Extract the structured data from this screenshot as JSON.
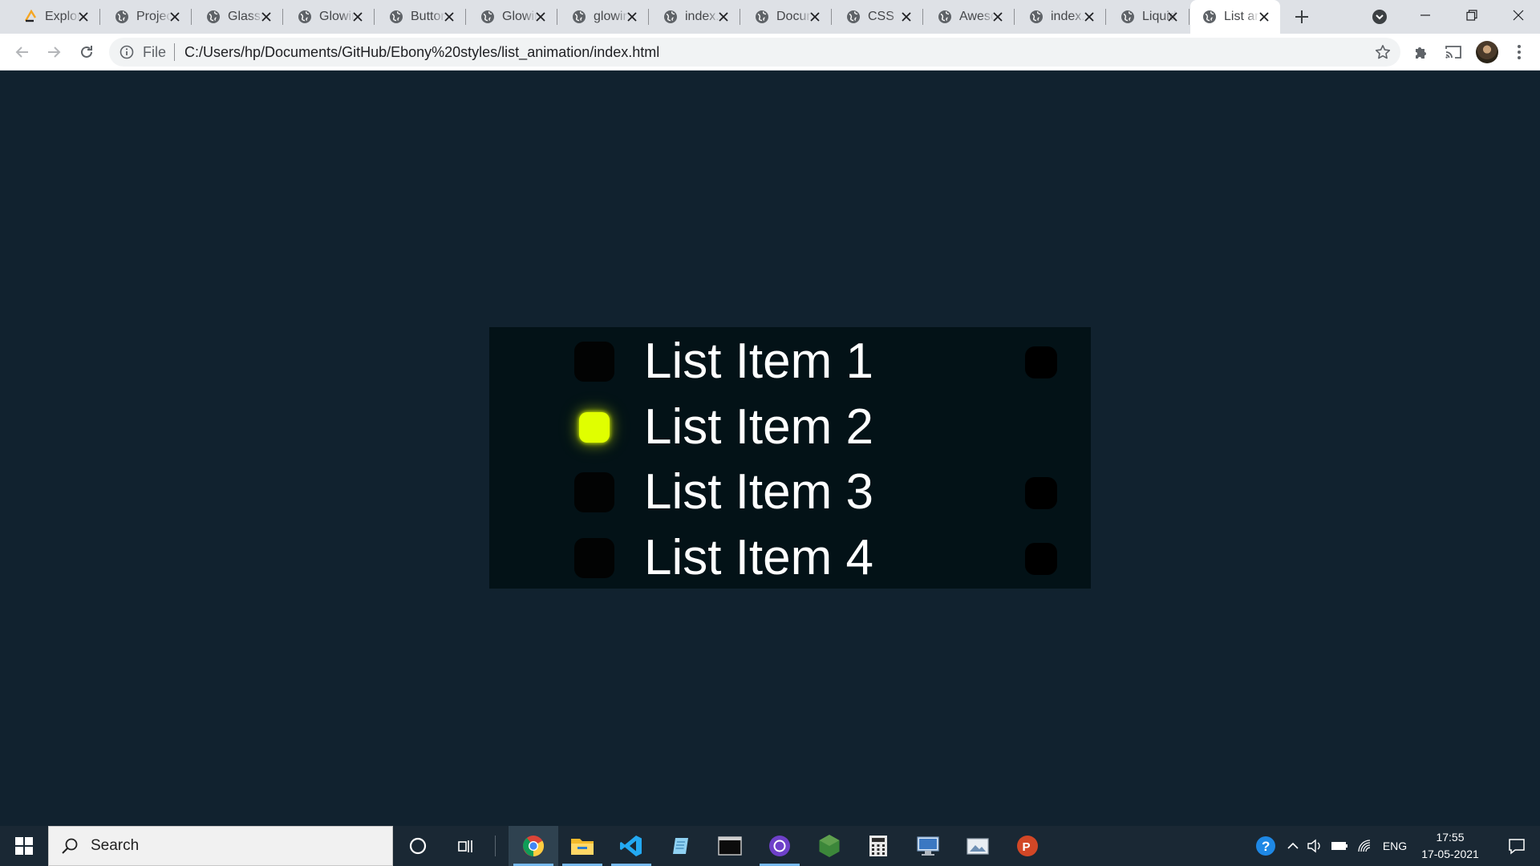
{
  "browser": {
    "tabs": [
      {
        "title": "Explore GitHub",
        "favicon": "codepen-icon"
      },
      {
        "title": "Projects",
        "favicon": "globe-icon"
      },
      {
        "title": "Glassmorphism",
        "favicon": "globe-icon"
      },
      {
        "title": "Glowing",
        "favicon": "globe-icon"
      },
      {
        "title": "Button",
        "favicon": "globe-icon"
      },
      {
        "title": "Glowing",
        "favicon": "globe-icon"
      },
      {
        "title": "glowing",
        "favicon": "globe-icon"
      },
      {
        "title": "index.html",
        "favicon": "globe-icon"
      },
      {
        "title": "Document",
        "favicon": "globe-icon"
      },
      {
        "title": "CSS",
        "favicon": "globe-icon"
      },
      {
        "title": "Awesome",
        "favicon": "globe-icon"
      },
      {
        "title": "index.html",
        "favicon": "globe-icon"
      },
      {
        "title": "Liquid",
        "favicon": "globe-icon"
      },
      {
        "title": "List animation",
        "favicon": "globe-icon",
        "active": true
      }
    ],
    "address_bar": {
      "scheme": "File",
      "url": "C:/Users/hp/Documents/GitHub/Ebony%20styles/list_animation/index.html"
    }
  },
  "page": {
    "items": [
      {
        "label": "List Item 1",
        "active": false,
        "end_dot": true
      },
      {
        "label": "List Item 2",
        "active": true,
        "end_dot": false
      },
      {
        "label": "List Item 3",
        "active": false,
        "end_dot": true
      },
      {
        "label": "List Item 4",
        "active": false,
        "end_dot": true
      }
    ],
    "colors": {
      "background": "#11222f",
      "list_background": "#031217",
      "active_bullet": "#e0ff00"
    }
  },
  "taskbar": {
    "search_placeholder": "Search",
    "apps": [
      "chrome-icon",
      "file-explorer-icon",
      "vscode-icon",
      "notepad-icon",
      "terminal-icon",
      "github-desktop-icon",
      "nodejs-icon",
      "calculator-icon",
      "remote-desktop-icon",
      "photos-icon",
      "powerpoint-icon"
    ],
    "language": "ENG",
    "time": "17:55",
    "date": "17-05-2021"
  }
}
